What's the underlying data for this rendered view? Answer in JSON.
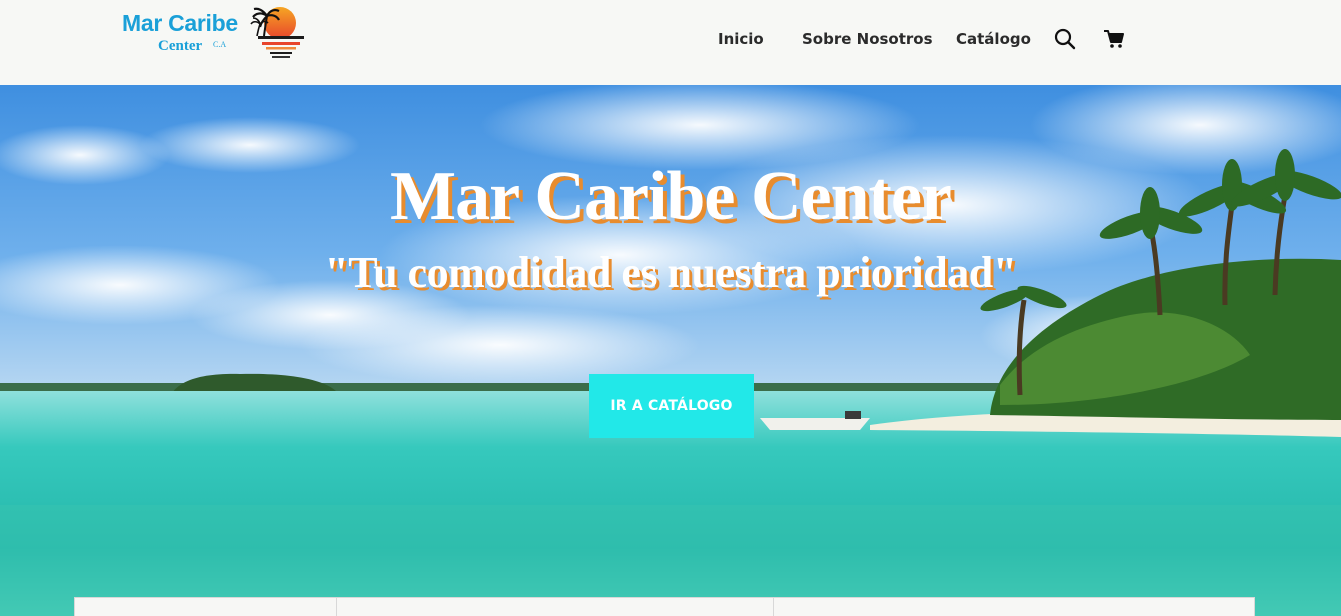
{
  "brand": {
    "name": "Mar Caribe",
    "sub": "Center",
    "suffix": "C.A",
    "color": "#1aa0d8"
  },
  "nav": {
    "links": [
      "Inicio",
      "Sobre Nosotros",
      "Catálogo"
    ],
    "search_icon": "search-icon",
    "cart_icon": "cart-icon"
  },
  "hero": {
    "title": "Mar Caribe Center",
    "subtitle": "\"Tu comodidad es nuestra prioridad\"",
    "cta_label": "IR A CATÁLOGO",
    "accent_color": "#e88c2e",
    "cta_color": "#22e8e8"
  }
}
